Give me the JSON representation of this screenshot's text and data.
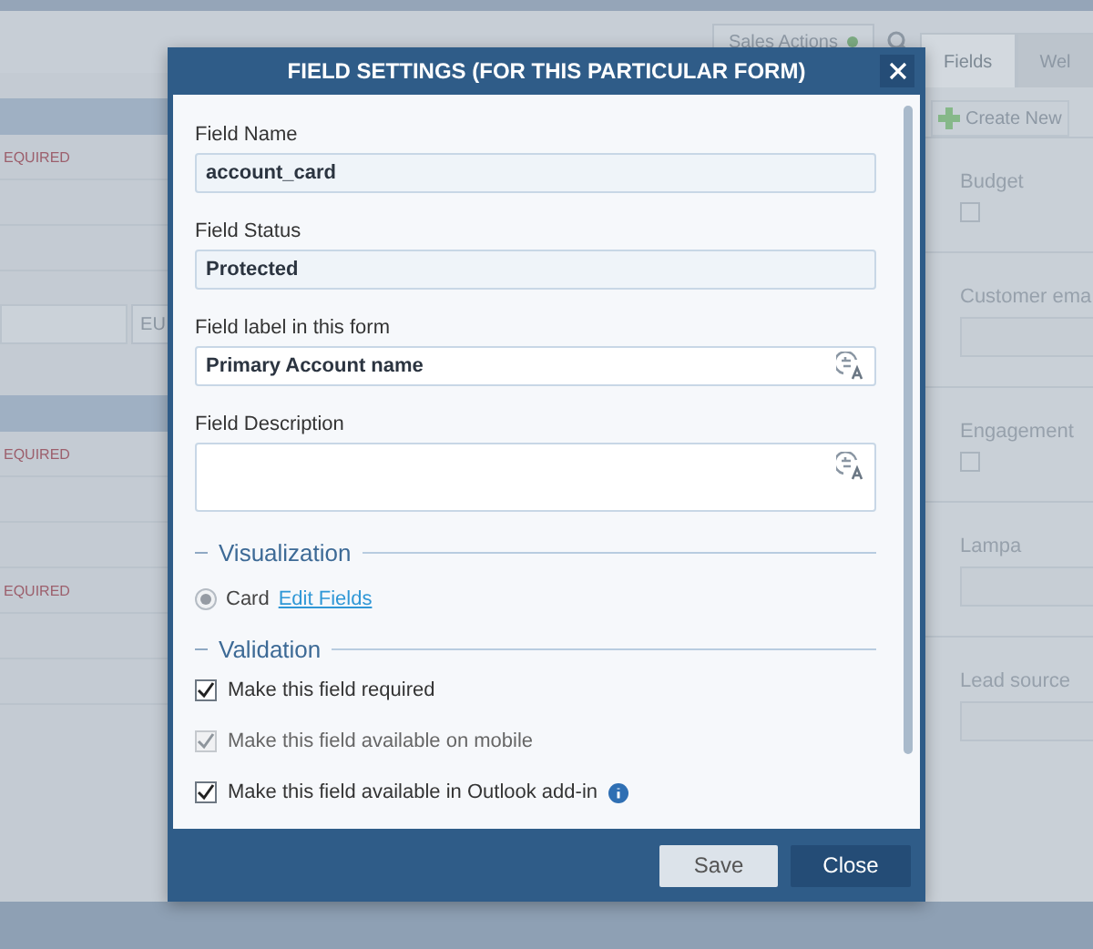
{
  "background": {
    "toolbar_button": "Sales Actions",
    "left_notes": [
      {
        "kind": "required",
        "text": "EQUIRED"
      },
      {
        "kind": "currency",
        "text": "EU"
      },
      {
        "kind": "required",
        "text": "EQUIRED"
      },
      {
        "kind": "required",
        "text": "EQUIRED"
      }
    ],
    "tabs": [
      {
        "label": "Fields",
        "selected": true
      },
      {
        "label": "Wel",
        "selected": false
      }
    ],
    "create_button": "Create New",
    "fields": [
      {
        "kind": "checkbox",
        "label": "Budget",
        "checked": false
      },
      {
        "kind": "input",
        "label": "Customer ema"
      },
      {
        "kind": "checkbox",
        "label": "Engagement",
        "checked": false
      },
      {
        "kind": "input",
        "label": "Lampa"
      },
      {
        "kind": "input",
        "label": "Lead source"
      }
    ]
  },
  "dialog": {
    "title": "FIELD SETTINGS (FOR THIS PARTICULAR FORM)",
    "fields": [
      {
        "kind": "readonly",
        "label": "Field Name",
        "value": "account_card"
      },
      {
        "kind": "readonly",
        "label": "Field Status",
        "value": "Protected"
      },
      {
        "kind": "text",
        "label": "Field label in this form",
        "value": "Primary Account name"
      },
      {
        "kind": "textarea",
        "label": "Field Description"
      }
    ],
    "visualization": {
      "heading": "Visualization",
      "option": {
        "label": "Card",
        "selected": true,
        "disabled": true
      },
      "link": "Edit Fields"
    },
    "validation": {
      "heading": "Validation",
      "options": [
        {
          "label": "Make this field required",
          "checked": true,
          "disabled": false,
          "info": false
        },
        {
          "label": "Make this field available on mobile",
          "checked": true,
          "disabled": true,
          "info": false
        },
        {
          "label": "Make this field available in Outlook add-in",
          "checked": true,
          "disabled": false,
          "info": true
        }
      ]
    },
    "buttons": [
      {
        "label": "Save",
        "kind": "secondary"
      },
      {
        "label": "Close",
        "kind": "primary"
      }
    ]
  }
}
